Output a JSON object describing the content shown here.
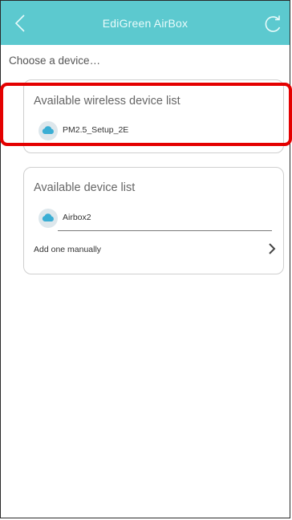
{
  "header": {
    "title": "EdiGreen AirBox",
    "back_icon": "chevron-left-icon",
    "refresh_icon": "refresh-icon"
  },
  "subtitle": "Choose a device…",
  "wireless_section": {
    "title": "Available wireless device list",
    "devices": [
      {
        "label": "PM2.5_Setup_2E",
        "icon": "cloud-icon"
      }
    ]
  },
  "device_section": {
    "title": "Available device list",
    "devices": [
      {
        "label": "Airbox2",
        "icon": "cloud-icon"
      }
    ],
    "add_manually_label": "Add one manually",
    "chevron_icon": "chevron-right-icon"
  },
  "colors": {
    "header_bg": "#5cc9cf",
    "highlight": "#e40000",
    "cloud_fg": "#3aaed4",
    "cloud_bg": "#dde7ec"
  }
}
